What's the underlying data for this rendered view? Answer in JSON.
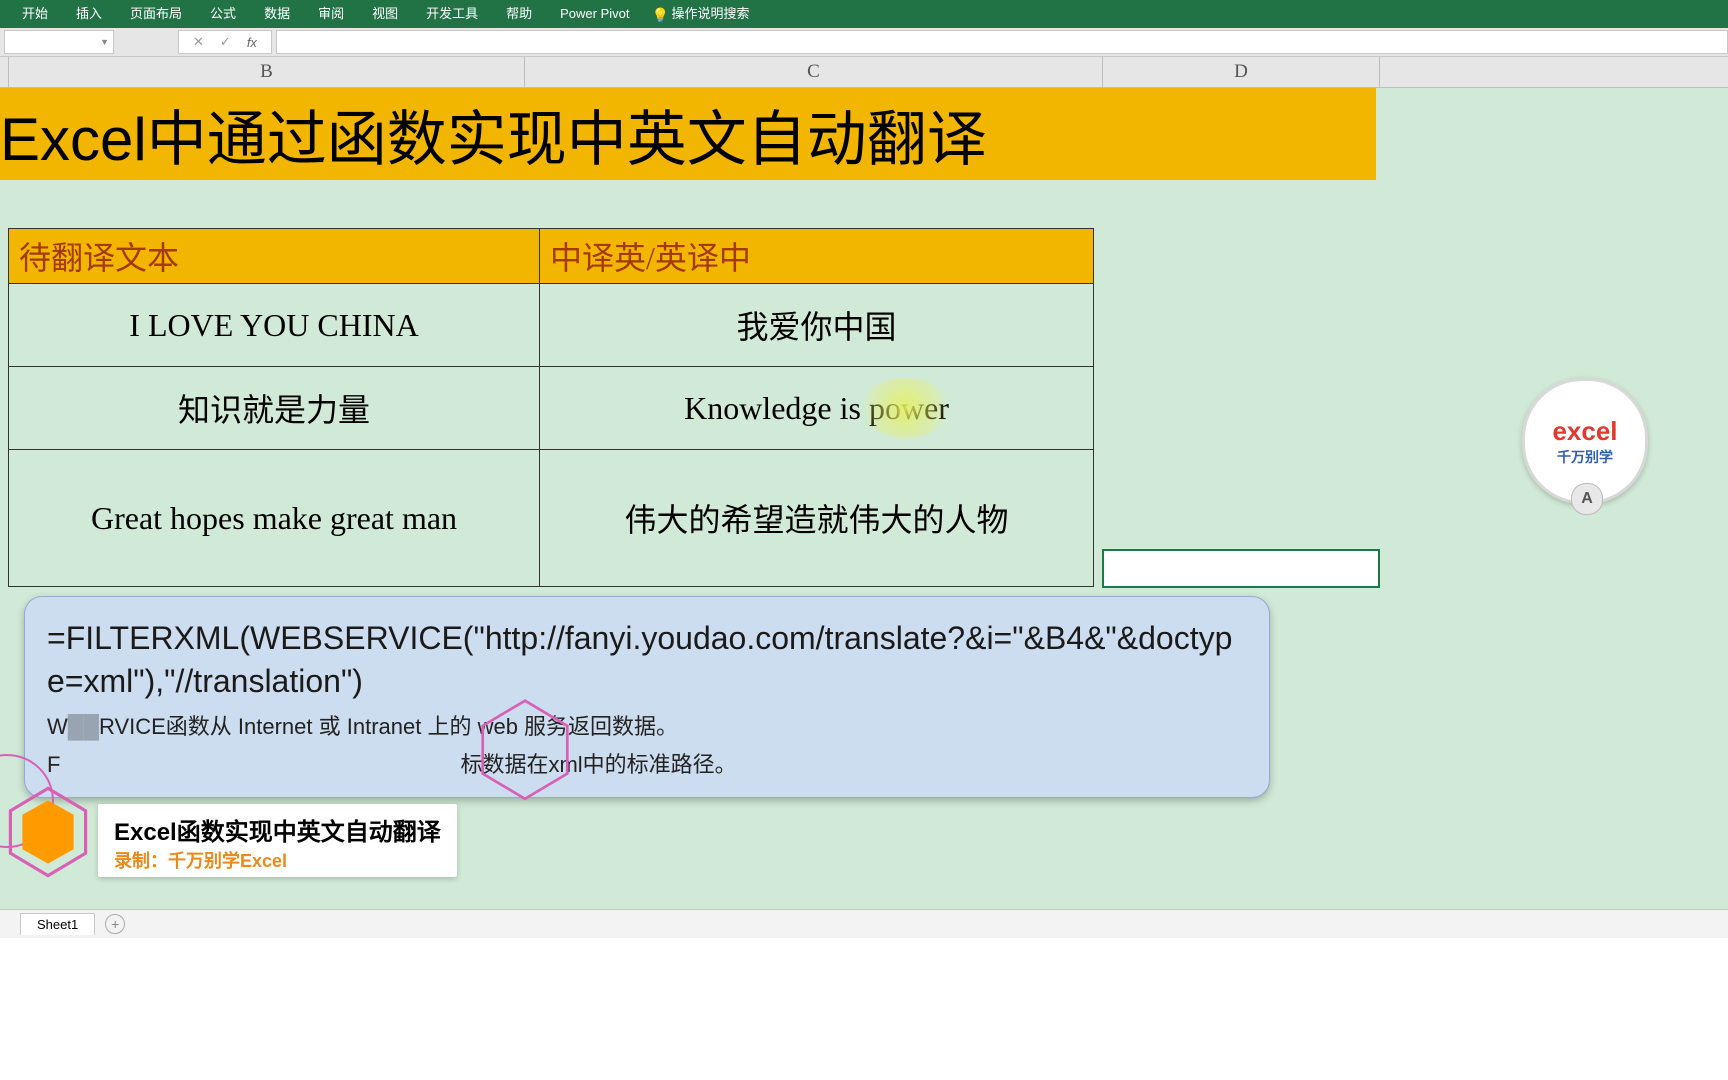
{
  "ribbon": {
    "tabs": [
      "开始",
      "插入",
      "页面布局",
      "公式",
      "数据",
      "审阅",
      "视图",
      "开发工具",
      "帮助",
      "Power Pivot"
    ],
    "tell_me": "操作说明搜索"
  },
  "name_box": "",
  "column_headers": {
    "B": "B",
    "C": "C",
    "D": "D"
  },
  "title": "Excel中通过函数实现中英文自动翻译",
  "table": {
    "header_left": "待翻译文本",
    "header_right": "中译英/英译中",
    "rows": [
      {
        "src": "I LOVE YOU CHINA",
        "dst": "我爱你中国"
      },
      {
        "src": "知识就是力量",
        "dst": "Knowledge is power"
      },
      {
        "src": "Great hopes make great man",
        "dst": "伟大的希望造就伟大的人物"
      }
    ]
  },
  "callout": {
    "formula": "=FILTERXML(WEBSERVICE(\"http://fanyi.youdao.com/translate?&i=\"&B4&\"&doctype=xml\"),\"//translation\")",
    "desc1_prefix": "W",
    "desc1_mid": "RVICE",
    "desc1_rest": "函数从 Internet 或 Intranet 上的 web 服务返回数据。",
    "desc2_prefix": "F",
    "desc2_rest": "标数据在xml中的标准路径。"
  },
  "watermark": {
    "line1": "excel",
    "line2": "千万别学",
    "badge": "A"
  },
  "video_label": {
    "line1": "Excel函数实现中英文自动翻译",
    "line2": "录制：千万别学Excel"
  },
  "sheet_tab": "Sheet1"
}
